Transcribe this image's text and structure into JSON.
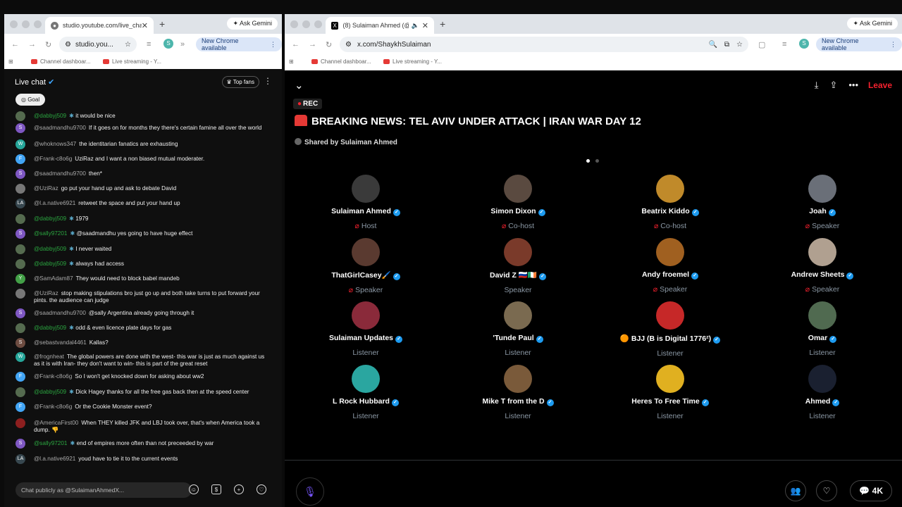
{
  "left_window": {
    "tab_title": "studio.youtube.com/live_cha",
    "omni_text": "studio.you...",
    "new_chrome": "New Chrome available",
    "ask_gemini": "Ask Gemini",
    "bookmarks": [
      "Channel dashboar...",
      "Live streaming - Y..."
    ],
    "chat": {
      "title": "Live chat",
      "top_fans": "Top fans",
      "goal": "Goal",
      "input_placeholder": "Chat publicly as @SulaimanAhmedX...",
      "messages": [
        {
          "user": "@dabbyj509",
          "text": "it would be nice",
          "member": true,
          "avatar_letter": "",
          "avatar_color": "#556b4f"
        },
        {
          "user": "@saadmandhu9700",
          "text": "If it goes on for months they there's certain famine all over the world",
          "member": false,
          "avatar_letter": "S",
          "avatar_color": "#7e57c2"
        },
        {
          "user": "@whoknows347",
          "text": "the identitarian fanatics are exhausting",
          "member": false,
          "avatar_letter": "W",
          "avatar_color": "#26a69a"
        },
        {
          "user": "@Frank-c8o6g",
          "text": "UziRaz and I want a non biased mutual moderater.",
          "member": false,
          "avatar_letter": "F",
          "avatar_color": "#42a5f5"
        },
        {
          "user": "@saadmandhu9700",
          "text": "then*",
          "member": false,
          "avatar_letter": "S",
          "avatar_color": "#7e57c2"
        },
        {
          "user": "@UziRaz",
          "text": "go put your hand up and ask to debate David",
          "member": false,
          "avatar_letter": "",
          "avatar_color": "#777777"
        },
        {
          "user": "@l.a.native6921",
          "text": "retweet the space and put your hand up",
          "member": false,
          "avatar_letter": "LA",
          "avatar_color": "#37474f"
        },
        {
          "user": "@dabbyj509",
          "text": "1979",
          "member": true,
          "avatar_letter": "",
          "avatar_color": "#556b4f"
        },
        {
          "user": "@sally97201",
          "text": "@saadmandhu yes going to have huge effect",
          "member": true,
          "avatar_letter": "S",
          "avatar_color": "#7e57c2"
        },
        {
          "user": "@dabbyj509",
          "text": "I never waited",
          "member": true,
          "avatar_letter": "",
          "avatar_color": "#556b4f"
        },
        {
          "user": "@dabbyj509",
          "text": "always had access",
          "member": true,
          "avatar_letter": "",
          "avatar_color": "#556b4f"
        },
        {
          "user": "@SamAdam87",
          "text": "They would need to block babel mandeb",
          "member": false,
          "avatar_letter": "Y",
          "avatar_color": "#43a047"
        },
        {
          "user": "@UziRaz",
          "text": "stop making stipulations bro just go up and both take turns to put forward your pints. the audience can judge",
          "member": false,
          "avatar_letter": "",
          "avatar_color": "#777777"
        },
        {
          "user": "@saadmandhu9700",
          "text": "@sally Argentina already going through it",
          "member": false,
          "avatar_letter": "S",
          "avatar_color": "#7e57c2"
        },
        {
          "user": "@dabbyj509",
          "text": "odd & even licence plate days for gas",
          "member": true,
          "avatar_letter": "",
          "avatar_color": "#556b4f"
        },
        {
          "user": "@sebastvandal4461",
          "text": "Kallas?",
          "member": false,
          "avatar_letter": "S",
          "avatar_color": "#6d4c41"
        },
        {
          "user": "@frognheat",
          "text": "The global powers are done with the west- this war is just as much against us as it is with Iran- they don't want to win- this is part of the great reset",
          "member": false,
          "avatar_letter": "W",
          "avatar_color": "#26a69a"
        },
        {
          "user": "@Frank-c8o6g",
          "text": "So I won't get knocked down for asking about ww2",
          "member": false,
          "avatar_letter": "F",
          "avatar_color": "#42a5f5"
        },
        {
          "user": "@dabbyj509",
          "text": "Dick Hagey thanks for all the free gas back then at the speed center",
          "member": true,
          "avatar_letter": "",
          "avatar_color": "#556b4f"
        },
        {
          "user": "@Frank-c8o6g",
          "text": "Or the Cookie Monster event?",
          "member": false,
          "avatar_letter": "F",
          "avatar_color": "#42a5f5"
        },
        {
          "user": "@AmericaFirst00",
          "text": "When THEY killed JFK and LBJ took over, that's when America took a dump. 👎",
          "member": false,
          "avatar_letter": "",
          "avatar_color": "#8d1f1f"
        },
        {
          "user": "@sally97201",
          "text": "end of empires more often than not preceeded by war",
          "member": true,
          "avatar_letter": "S",
          "avatar_color": "#7e57c2"
        },
        {
          "user": "@l.a.native6921",
          "text": "youd have to tie it to the current events",
          "member": false,
          "avatar_letter": "LA",
          "avatar_color": "#37474f"
        }
      ]
    }
  },
  "right_window": {
    "tab_title": "(8) Sulaiman Ahmed (@Sh",
    "omni_text": "x.com/ShaykhSulaiman",
    "new_chrome": "New Chrome available",
    "ask_gemini": "Ask Gemini",
    "bookmarks": [
      "Channel dashboar...",
      "Live streaming - Y..."
    ],
    "space": {
      "leave": "Leave",
      "rec": "REC",
      "title": "BREAKING NEWS: TEL AVIV UNDER ATTACK | IRAN WAR DAY 12",
      "shared_by": "Shared by Sulaiman Ahmed",
      "reply_count": "4K",
      "people": [
        {
          "name": "Sulaiman Ahmed",
          "role": "Host",
          "verified": true,
          "mic": true,
          "color": "#3a3a3a"
        },
        {
          "name": "Simon Dixon",
          "role": "Co-host",
          "verified": true,
          "mic": true,
          "color": "#5a4a40"
        },
        {
          "name": "Beatrix Kiddo",
          "role": "Co-host",
          "verified": true,
          "mic": true,
          "color": "#c08a2a"
        },
        {
          "name": "Joah",
          "role": "Speaker",
          "verified": true,
          "mic": true,
          "color": "#6a6f78"
        },
        {
          "name": "ThatGirlCasey🖌️",
          "role": "Speaker",
          "verified": true,
          "mic": true,
          "color": "#5a3a30"
        },
        {
          "name": "David Z 🇷🇺🇮🇪",
          "role": "Speaker",
          "verified": true,
          "mic": false,
          "color": "#7a3a2a"
        },
        {
          "name": "Andy froemel",
          "role": "Speaker",
          "verified": true,
          "mic": true,
          "color": "#a06020"
        },
        {
          "name": "Andrew Sheets",
          "role": "Speaker",
          "verified": true,
          "mic": true,
          "color": "#b0a090"
        },
        {
          "name": "Sulaiman Updates",
          "role": "Listener",
          "verified": true,
          "mic": false,
          "color": "#8a2a3a"
        },
        {
          "name": "'Tunde Paul",
          "role": "Listener",
          "verified": true,
          "mic": false,
          "color": "#7a6a50"
        },
        {
          "name": "🟠 BJJ (B is Digital 1776²)",
          "role": "Listener",
          "verified": true,
          "mic": false,
          "color": "#c62828"
        },
        {
          "name": "Omar",
          "role": "Listener",
          "verified": true,
          "mic": false,
          "color": "#506a50"
        },
        {
          "name": "L Rock Hubbard",
          "role": "Listener",
          "verified": true,
          "mic": false,
          "color": "#2aa6a0"
        },
        {
          "name": "Mike T from the D",
          "role": "Listener",
          "verified": true,
          "mic": false,
          "color": "#7a5a3a"
        },
        {
          "name": "Heres To Free Time",
          "role": "Listener",
          "verified": true,
          "mic": false,
          "color": "#e0b020"
        },
        {
          "name": "Ahmed",
          "role": "Listener",
          "verified": true,
          "mic": false,
          "color": "#1a2030"
        }
      ]
    }
  }
}
